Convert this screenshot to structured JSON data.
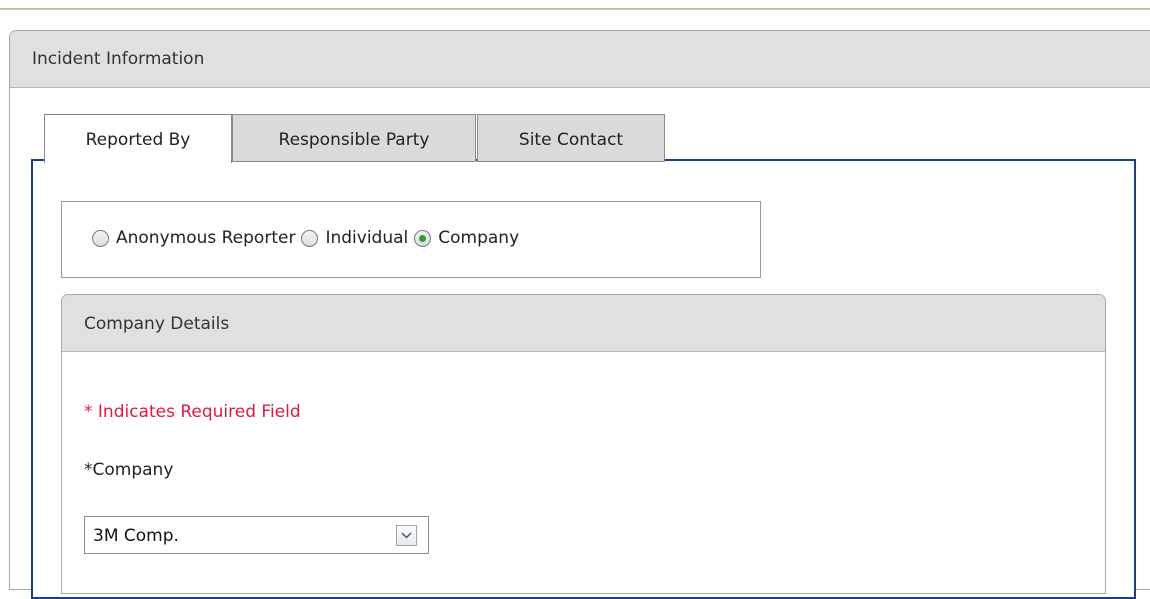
{
  "panel": {
    "title": "Incident Information"
  },
  "tabs": [
    {
      "label": "Reported By",
      "active": true
    },
    {
      "label": "Responsible Party",
      "active": false
    },
    {
      "label": "Site Contact",
      "active": false
    }
  ],
  "reporter_type": {
    "options": [
      {
        "label": "Anonymous Reporter",
        "checked": false
      },
      {
        "label": "Individual",
        "checked": false
      },
      {
        "label": "Company",
        "checked": true
      }
    ]
  },
  "company_details": {
    "title": "Company Details",
    "required_note": "* Indicates Required Field",
    "company_label": "*Company",
    "company_value": "3M Comp."
  },
  "colors": {
    "tab_border_accent": "#1c3d8c",
    "required_text": "#e3173e",
    "radio_selected": "#2f9e2f",
    "header_background": "#e0e0e0"
  },
  "icons": {
    "dropdown": "chevron-down-icon",
    "radio_selected": "radio-checked-icon",
    "radio_unselected": "radio-unchecked-icon"
  }
}
